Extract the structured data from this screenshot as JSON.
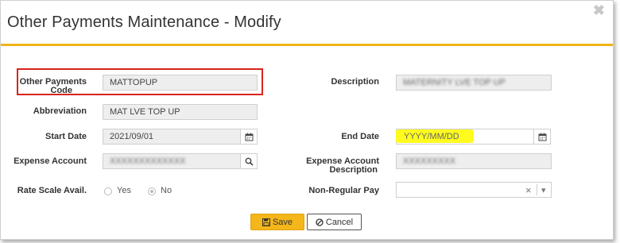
{
  "dialog": {
    "title": "Other Payments Maintenance - Modify",
    "close_label": "✖"
  },
  "fields": {
    "code": {
      "label_line1": "Other Payments",
      "label_line2": "Code",
      "value": "MATTOPUP"
    },
    "description": {
      "label": "Description",
      "value": "MATERNITY LVE TOP UP"
    },
    "abbreviation": {
      "label": "Abbreviation",
      "value": "MAT LVE TOP UP"
    },
    "start_date": {
      "label": "Start Date",
      "value": "2021/09/01"
    },
    "end_date": {
      "label": "End Date",
      "placeholder": "YYYY/MM/DD"
    },
    "expense_account": {
      "label": "Expense Account",
      "value": "XXXXXXXXXXXXX"
    },
    "expense_account_desc": {
      "label_line1": "Expense Account",
      "label_line2": "Description",
      "value": "XXXXXXXXX"
    },
    "rate_scale": {
      "label": "Rate Scale Avail.",
      "options": [
        "Yes",
        "No"
      ],
      "selected": "No"
    },
    "non_regular_pay": {
      "label": "Non-Regular Pay",
      "value": "",
      "clear": "×",
      "caret": "▾"
    }
  },
  "buttons": {
    "save": "Save",
    "cancel": "Cancel"
  },
  "colors": {
    "accent": "#f2b318",
    "annotation_box": "#d9241c",
    "highlight": "#fffb1f"
  }
}
